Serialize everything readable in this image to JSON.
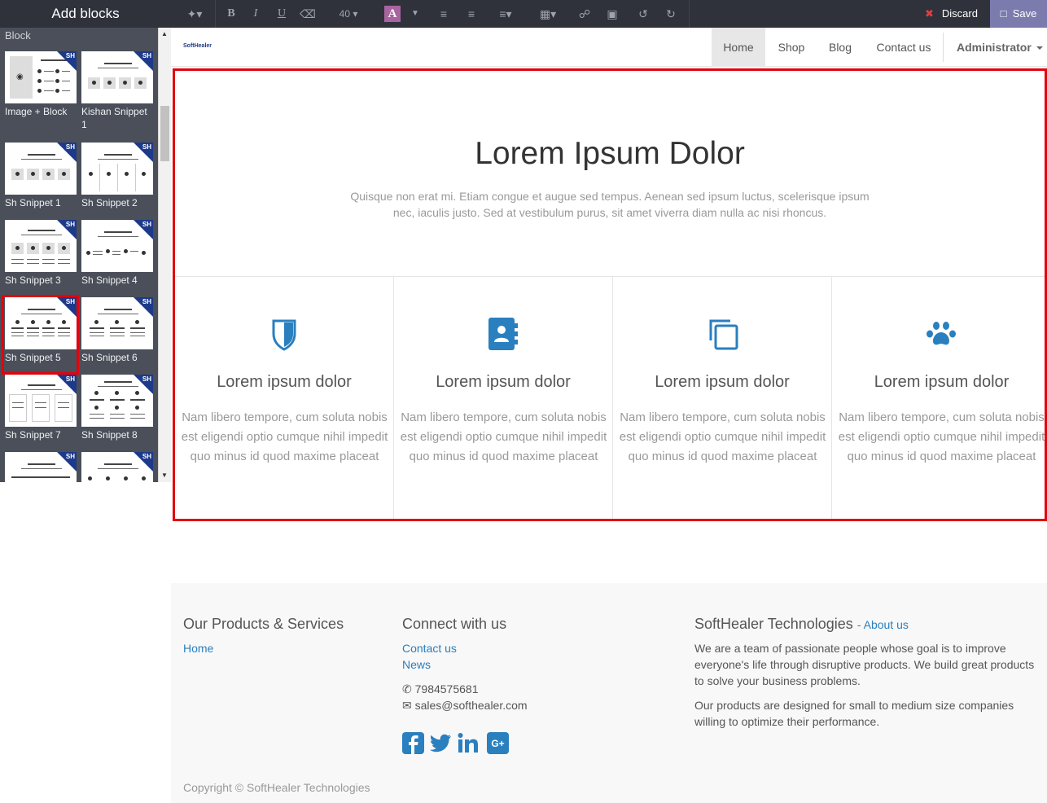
{
  "sidebar": {
    "title": "Add blocks",
    "category": "Block",
    "snippets": [
      {
        "label": "Image + Block"
      },
      {
        "label": "Kishan Snippet 1"
      },
      {
        "label": "Sh Snippet 1"
      },
      {
        "label": "Sh Snippet 2"
      },
      {
        "label": "Sh Snippet 3"
      },
      {
        "label": "Sh Snippet 4"
      },
      {
        "label": "Sh Snippet 5"
      },
      {
        "label": "Sh Snippet 6"
      },
      {
        "label": "Sh Snippet 7"
      },
      {
        "label": "Sh Snippet 8"
      }
    ],
    "selected": "Sh Snippet 5"
  },
  "toolbar": {
    "font_size": "40",
    "color_letter": "A",
    "discard_label": "Discard",
    "save_label": "Save"
  },
  "navbar": {
    "logo_text": "SoftHealer",
    "items": [
      {
        "label": "Home",
        "active": true
      },
      {
        "label": "Shop"
      },
      {
        "label": "Blog"
      },
      {
        "label": "Contact us"
      }
    ],
    "user": "Administrator"
  },
  "hero": {
    "title": "Lorem Ipsum Dolor",
    "subtitle": "Quisque non erat mi. Etiam congue et augue sed tempus. Aenean sed ipsum luctus, scelerisque ipsum nec, iaculis justo. Sed at vestibulum purus, sit amet viverra diam nulla ac nisi rhoncus."
  },
  "features": [
    {
      "icon": "shield-icon",
      "title": "Lorem ipsum dolor",
      "text": "Nam libero tempore, cum soluta nobis est eligendi optio cumque nihil impedit quo minus id quod maxime placeat"
    },
    {
      "icon": "address-book-icon",
      "title": "Lorem ipsum dolor",
      "text": "Nam libero tempore, cum soluta nobis est eligendi optio cumque nihil impedit quo minus id quod maxime placeat"
    },
    {
      "icon": "clone-icon",
      "title": "Lorem ipsum dolor",
      "text": "Nam libero tempore, cum soluta nobis est eligendi optio cumque nihil impedit quo minus id quod maxime placeat"
    },
    {
      "icon": "paw-icon",
      "title": "Lorem ipsum dolor",
      "text": "Nam libero tempore, cum soluta nobis est eligendi optio cumque nihil impedit quo minus id quod maxime placeat"
    }
  ],
  "feature_icon_color": "#2a7fbf",
  "footer": {
    "products_heading": "Our Products & Services",
    "products_links": [
      "Home"
    ],
    "connect_heading": "Connect with us",
    "connect_links": [
      "Contact us",
      "News"
    ],
    "phone": "7984575681",
    "email": "sales@softhealer.com",
    "social": [
      "facebook-icon",
      "twitter-icon",
      "linkedin-icon",
      "google-plus-icon"
    ],
    "company_heading": "SoftHealer Technologies",
    "about_separator": "-",
    "about_link": "About us",
    "about_text_1": "We are a team of passionate people whose goal is to improve everyone's life through disruptive products. We build great products to solve your business problems.",
    "about_text_2": "Our products are designed for small to medium size companies willing to optimize their performance.",
    "copyright": "Copyright © SoftHealer Technologies"
  }
}
